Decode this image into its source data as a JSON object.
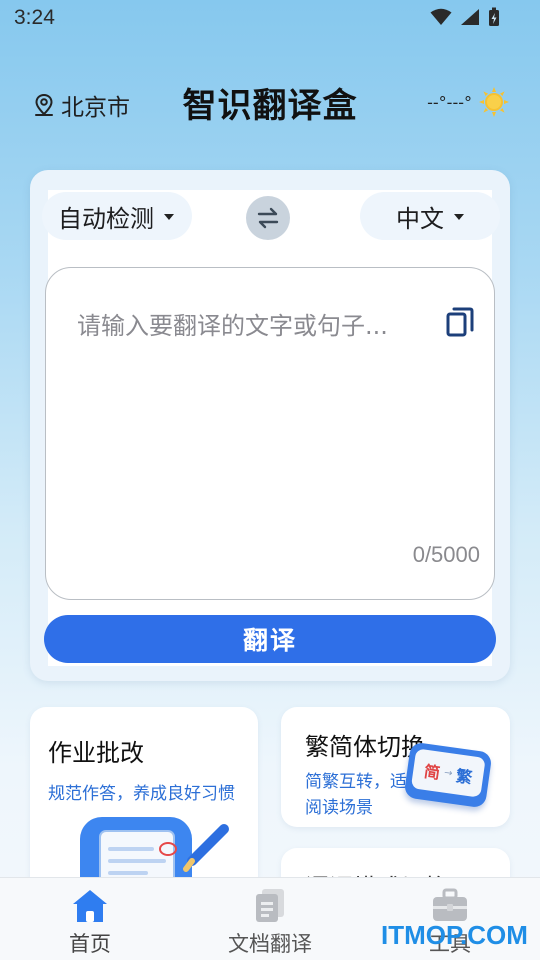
{
  "status_bar": {
    "time": "3:24"
  },
  "header": {
    "location": "北京市",
    "title": "智识翻译盒",
    "weather": "--°---°"
  },
  "translator": {
    "source_lang": "自动检测",
    "target_lang": "中文",
    "placeholder": "请输入要翻译的文字或句子...",
    "char_count": "0/5000",
    "translate_label": "翻译"
  },
  "features": {
    "homework": {
      "title": "作业批改",
      "desc": "规范作答，养成良好习惯"
    },
    "convert": {
      "title": "繁简体切换",
      "desc": "简繁互转，适配阅读场景",
      "badge_simplified": "简",
      "badge_traditional": "繁"
    },
    "third": {
      "title": "语调模式切换"
    }
  },
  "bottom_nav": {
    "items": [
      {
        "label": "首页",
        "icon": "home-icon"
      },
      {
        "label": "文档翻译",
        "icon": "document-icon"
      },
      {
        "label": "工具",
        "icon": "toolbox-icon"
      }
    ]
  },
  "watermark": {
    "part1": "IT",
    "part2": "MOP",
    "part3": ".COM"
  },
  "colors": {
    "accent": "#2f6fe8",
    "desc_blue": "#2c6fd6"
  }
}
